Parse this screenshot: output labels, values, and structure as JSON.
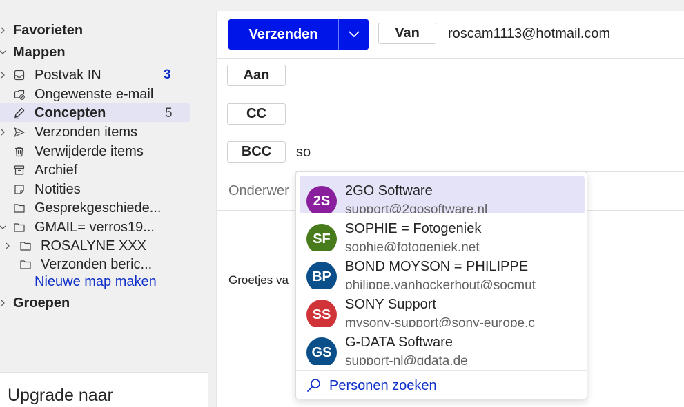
{
  "sidebar": {
    "favorites_label": "Favorieten",
    "folders_label": "Mappen",
    "folders": [
      {
        "label": "Postvak IN",
        "count": "3",
        "icon": "inbox-icon"
      },
      {
        "label": "Ongewenste e-mail",
        "icon": "junk-icon"
      },
      {
        "label": "Concepten",
        "count": "5",
        "icon": "drafts-icon"
      },
      {
        "label": "Verzonden items",
        "icon": "sent-icon"
      },
      {
        "label": "Verwijderde items",
        "icon": "trash-icon"
      },
      {
        "label": "Archief",
        "icon": "archive-icon"
      },
      {
        "label": "Notities",
        "icon": "notes-icon"
      },
      {
        "label": "Gesprekgeschiede...",
        "icon": "folder-icon"
      }
    ],
    "gmail_account": "GMAIL= verros19...",
    "gmail_subfolders": [
      {
        "label": "ROSALYNE XXX",
        "icon": "folder-icon"
      },
      {
        "label": "Verzonden beric...",
        "icon": "folder-icon"
      }
    ],
    "new_folder_link": "Nieuwe map maken",
    "groups_label": "Groepen",
    "upgrade_text": "Upgrade naar"
  },
  "compose": {
    "send_label": "Verzenden",
    "from_label": "Van",
    "from_address": "roscam1113@hotmail.com",
    "to_label": "Aan",
    "cc_label": "CC",
    "bcc_label": "BCC",
    "bcc_value": "so",
    "subject_placeholder": "Onderwer",
    "body_text": "Groetjes va"
  },
  "suggestions": {
    "items": [
      {
        "initials": "2S",
        "name": "2GO Software",
        "email": "support@2gosoftware.nl",
        "color": "#8a1f9e"
      },
      {
        "initials": "SF",
        "name": "SOPHIE = Fotogeniek",
        "email": "sophie@fotogeniek.net",
        "color": "#487b1c"
      },
      {
        "initials": "BP",
        "name": "BOND MOYSON = PHILIPPE",
        "email": "philippe.vanhockerhout@socmut",
        "color": "#0b4f8a"
      },
      {
        "initials": "SS",
        "name": "SONY Support",
        "email": "mysony-support@sony-europe.c",
        "color": "#d13438"
      },
      {
        "initials": "GS",
        "name": "G-DATA Software",
        "email": "support-nl@gdata.de",
        "color": "#0b4f8a"
      }
    ],
    "search_people_label": "Personen zoeken"
  }
}
